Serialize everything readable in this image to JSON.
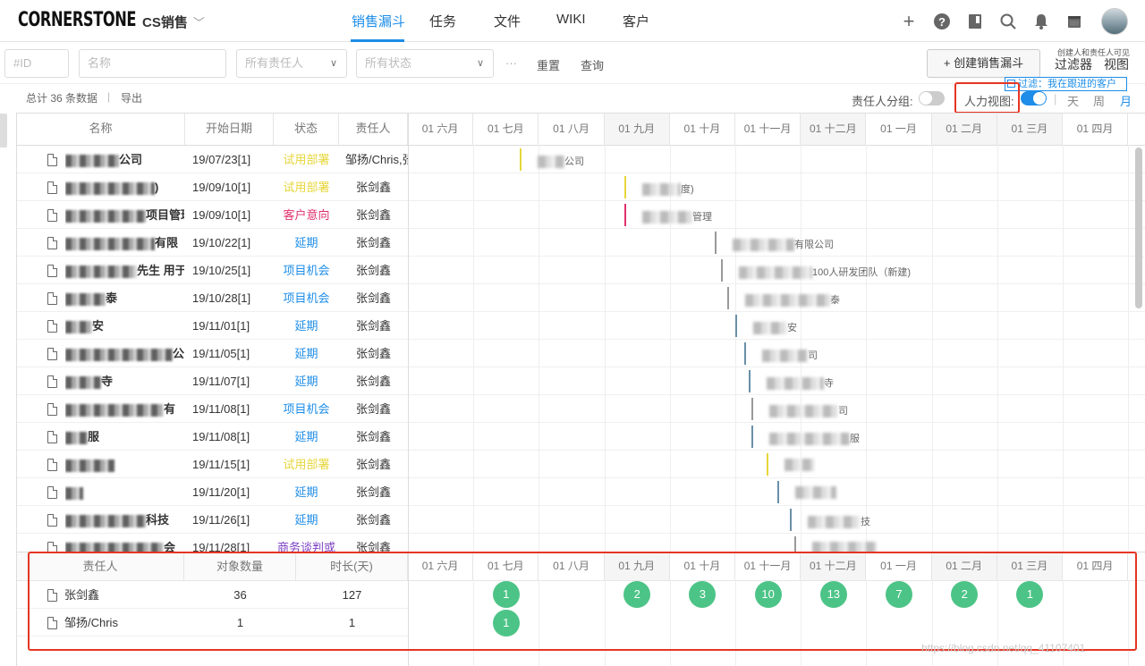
{
  "app": {
    "logo": "CORNERSTONE",
    "project": "CS销售",
    "nav": [
      "销售漏斗",
      "任务",
      "文件",
      "WIKI",
      "客户"
    ]
  },
  "filters": {
    "id_placeholder": "#ID",
    "name_placeholder": "名称",
    "owner_placeholder": "所有责任人",
    "status_placeholder": "所有状态",
    "more": "···",
    "reset": "重置",
    "query": "查询",
    "create": "+ 创建销售漏斗",
    "note": "创建人和责任人可见",
    "filter_label": "过滤器",
    "view_label": "视图"
  },
  "summary": {
    "total": "总计 36 条数据",
    "separator": "|",
    "export": "导出",
    "active_filter": "过滤：我在跟进的客户",
    "group_by_owner": "责任人分组:",
    "manpower_view": "人力视图:",
    "view_sep": "|",
    "day": "天",
    "week": "周",
    "month": "月"
  },
  "colors": {
    "accent": "#1d8de8",
    "trial": "#e6d63a",
    "intent": "#e0306e",
    "delay": "#1d8de8",
    "opportunity": "#1d8de8",
    "negotiation": "#7b3fc2",
    "bubble": "#4dc487",
    "highlight": "#e53523"
  },
  "table": {
    "headers": [
      "名称",
      "开始日期",
      "状态",
      "责任人"
    ],
    "months": [
      "01 六月",
      "01 七月",
      "01 八月",
      "01 九月",
      "01 十月",
      "01 十一月",
      "01 十二月",
      "01 一月",
      "01 二月",
      "01 三月",
      "01 四月"
    ],
    "rows": [
      {
        "name": "公司",
        "date": "19/07/23[1]",
        "status": "试用部署",
        "owner": "邹扬/Chris,张",
        "gantt_label": "公司"
      },
      {
        "name": ")",
        "date": "19/09/10[1]",
        "status": "试用部署",
        "owner": "张剑鑫",
        "gantt_label": "度)"
      },
      {
        "name": "项目管理",
        "date": "19/09/10[1]",
        "status": "客户意向",
        "owner": "张剑鑫",
        "gantt_label": "管理"
      },
      {
        "name": "有限",
        "date": "19/10/22[1]",
        "status": "延期",
        "owner": "张剑鑫",
        "gantt_label": "有限公司"
      },
      {
        "name": "先生 用于",
        "date": "19/10/25[1]",
        "status": "项目机会",
        "owner": "张剑鑫",
        "gantt_label": "100人研发团队（新建)"
      },
      {
        "name": "泰",
        "date": "19/10/28[1]",
        "status": "项目机会",
        "owner": "张剑鑫",
        "gantt_label": "泰"
      },
      {
        "name": "安",
        "date": "19/11/01[1]",
        "status": "延期",
        "owner": "张剑鑫",
        "gantt_label": "安"
      },
      {
        "name": "公司",
        "date": "19/11/05[1]",
        "status": "延期",
        "owner": "张剑鑫",
        "gantt_label": "司"
      },
      {
        "name": "寺",
        "date": "19/11/07[1]",
        "status": "延期",
        "owner": "张剑鑫",
        "gantt_label": "寺"
      },
      {
        "name": "有",
        "date": "19/11/08[1]",
        "status": "项目机会",
        "owner": "张剑鑫",
        "gantt_label": "司"
      },
      {
        "name": "服",
        "date": "19/11/08[1]",
        "status": "延期",
        "owner": "张剑鑫",
        "gantt_label": "服"
      },
      {
        "name": "",
        "date": "19/11/15[1]",
        "status": "试用部署",
        "owner": "张剑鑫",
        "gantt_label": ""
      },
      {
        "name": "",
        "date": "19/11/20[1]",
        "status": "延期",
        "owner": "张剑鑫",
        "gantt_label": ""
      },
      {
        "name": "科技",
        "date": "19/11/26[1]",
        "status": "延期",
        "owner": "张剑鑫",
        "gantt_label": "技"
      },
      {
        "name": "会",
        "date": "19/11/28[1]",
        "status": "商务谈判或",
        "owner": "张剑鑫",
        "gantt_label": ""
      }
    ]
  },
  "manpower": {
    "headers": [
      "责任人",
      "对象数量",
      "时长(天)"
    ],
    "rows": [
      {
        "owner": "张剑鑫",
        "count": "36",
        "days": "127"
      },
      {
        "owner": "邹扬/Chris",
        "count": "1",
        "days": "1"
      }
    ],
    "bubbles_row1": [
      "1",
      "2",
      "3",
      "10",
      "13",
      "7",
      "2",
      "1"
    ],
    "bubbles_row2": [
      "1"
    ]
  },
  "watermark": "https://blog.csdn.net/qq_41107401"
}
